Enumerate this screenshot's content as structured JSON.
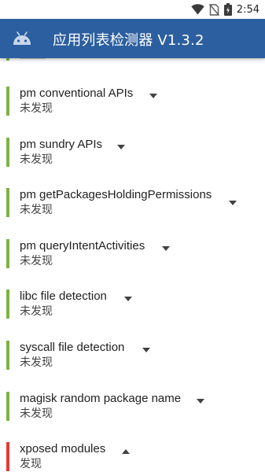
{
  "status_bar": {
    "time": "2:54",
    "icons": [
      "wifi-icon",
      "no-sim-icon",
      "battery-icon"
    ]
  },
  "toolbar": {
    "app_icon": "android-icon",
    "title": "应用列表检测器 V1.3.2",
    "color": "#2c5fa0"
  },
  "colors": {
    "not_found": "#7cb342",
    "found": "#e53935"
  },
  "items": [
    {
      "title": "pm conventional APIs",
      "status": "未发现",
      "state": "not_found",
      "expanded": false
    },
    {
      "title": "pm sundry APIs",
      "status": "未发现",
      "state": "not_found",
      "expanded": false
    },
    {
      "title": "pm getPackagesHoldingPermissions",
      "status": "未发现",
      "state": "not_found",
      "expanded": false
    },
    {
      "title": "pm queryIntentActivities",
      "status": "未发现",
      "state": "not_found",
      "expanded": false
    },
    {
      "title": "libc file detection",
      "status": "未发现",
      "state": "not_found",
      "expanded": false
    },
    {
      "title": "syscall file detection",
      "status": "未发现",
      "state": "not_found",
      "expanded": false
    },
    {
      "title": "magisk random package name",
      "status": "未发现",
      "state": "not_found",
      "expanded": false
    },
    {
      "title": "xposed modules",
      "status": "发现",
      "state": "found",
      "expanded": true
    }
  ]
}
